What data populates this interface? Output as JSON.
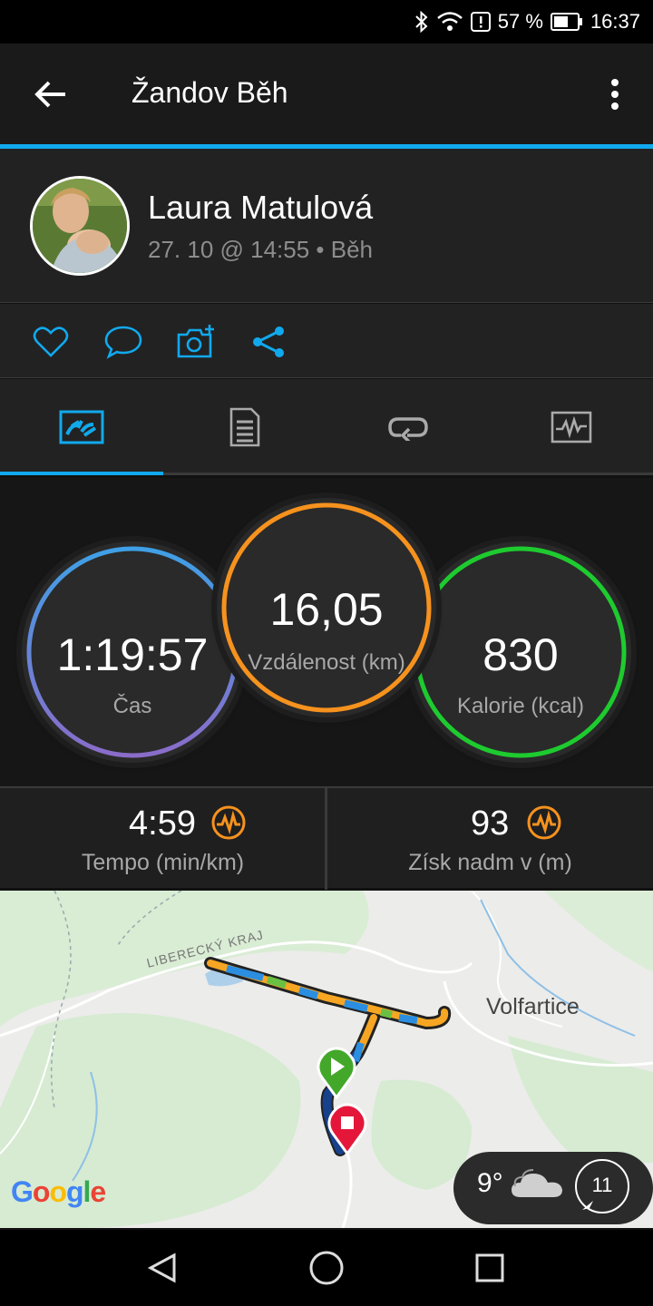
{
  "status_bar": {
    "battery": "57 %",
    "time": "16:37"
  },
  "app_bar": {
    "title": "Žandov Běh"
  },
  "profile": {
    "name": "Laura Matulová",
    "meta": "27. 10 @ 14:55 • Běh"
  },
  "stats": {
    "time": {
      "value": "1:19:57",
      "label": "Čas",
      "color": "#3fa0e6"
    },
    "distance": {
      "value": "16,05",
      "label": "Vzdálenost (km)",
      "color": "#f6921e"
    },
    "calories": {
      "value": "830",
      "label": "Kalorie (kcal)",
      "color": "#1ecb2f"
    }
  },
  "lower_stats": {
    "pace": {
      "value": "4:59",
      "label": "Tempo (min/km)"
    },
    "elevation": {
      "value": "93",
      "label": "Získ nadm v (m)"
    }
  },
  "map": {
    "town_label": "Volfartice",
    "region_label": "LIBERECKÝ KRAJ",
    "google": [
      "G",
      "o",
      "o",
      "g",
      "l",
      "e"
    ],
    "weather_temp": "9°",
    "wind": "11"
  },
  "colors": {
    "accent": "#11a9ed",
    "orange": "#f6921e"
  }
}
